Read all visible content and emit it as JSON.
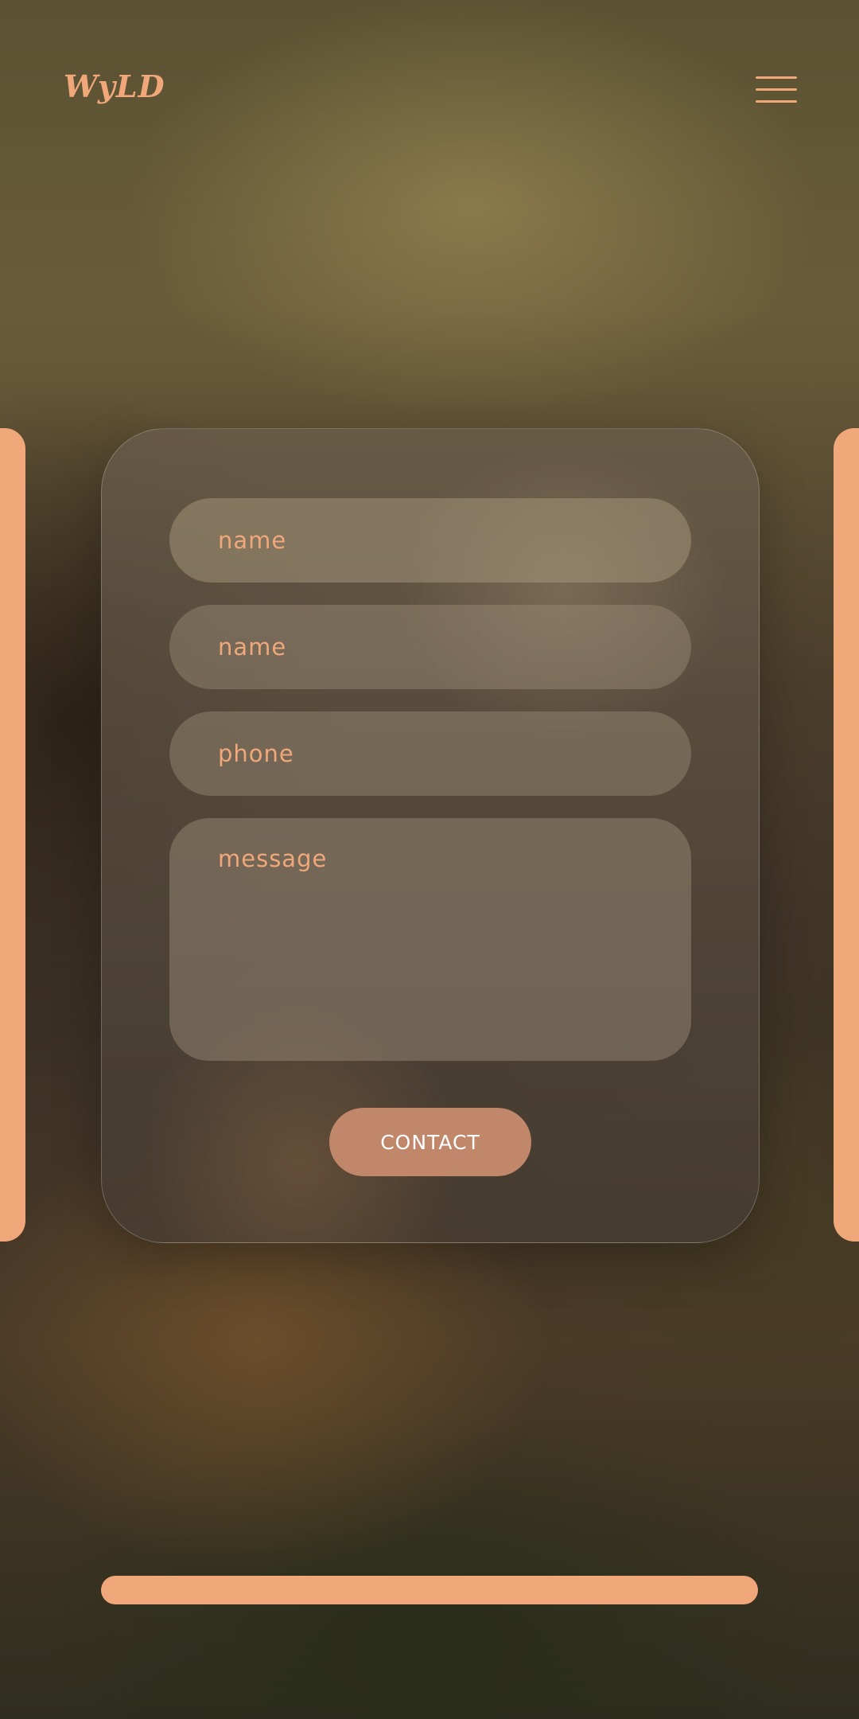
{
  "header": {
    "logo_text": "WyLD",
    "menu_icon": "hamburger-menu-icon"
  },
  "form": {
    "field_1_placeholder": "name",
    "field_2_placeholder": "name",
    "field_3_placeholder": "phone",
    "message_placeholder": "message",
    "submit_label": "CONTACT"
  },
  "colors": {
    "accent": "#f0a77a",
    "button": "#c0876a",
    "button_text": "#ffffff"
  }
}
